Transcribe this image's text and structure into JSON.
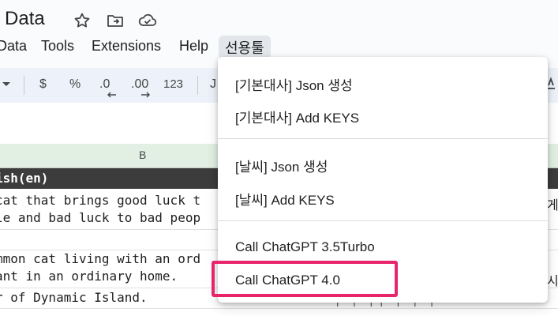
{
  "title": {
    "text": "e Data"
  },
  "title_icons": [
    "star-icon",
    "move-to-folder-icon",
    "cloud-saved-icon"
  ],
  "menu": {
    "items": [
      "Data",
      "Tools",
      "Extensions",
      "Help",
      "선용툴"
    ]
  },
  "toolbar": {
    "currency": "$",
    "percent": "%",
    "decrease_decimal": ".0",
    "increase_decimal": ".00",
    "number_format": "123",
    "partial_font": "J"
  },
  "sheet": {
    "column_letter": "B",
    "header_cell": "ish(en)",
    "rows": [
      "cat that brings good luck t",
      "le and bad luck to bad peop",
      "mmon cat living with an ord",
      "ant in an ordinary home.",
      "r of Dynamic Island."
    ],
    "right_fragments": [
      "게",
      "시"
    ],
    "bottom_fragment": "ㅓ ㅓ ㅓㅓ ㅓ ㅓ ㅓ"
  },
  "dropdown": {
    "items": [
      "[기본대사] Json 생성",
      "[기본대사] Add KEYS",
      "[날씨] Json 생성",
      "[날씨] Add KEYS",
      "Call ChatGPT 3.5Turbo",
      "Call ChatGPT 4.0"
    ]
  },
  "colors": {
    "highlight_border": "#e8246b",
    "header_row_bg": "#3c3c3c",
    "column_header_bg": "#e1f0e3"
  }
}
